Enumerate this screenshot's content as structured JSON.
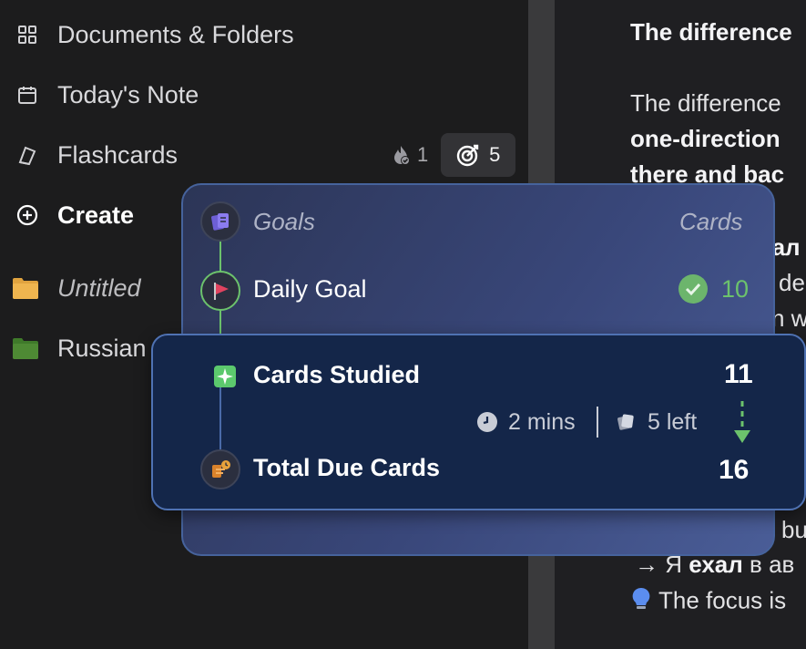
{
  "sidebar": {
    "items": [
      {
        "label": "Documents & Folders",
        "icon": "grid-icon"
      },
      {
        "label": "Today's Note",
        "icon": "calendar-icon"
      },
      {
        "label": "Flashcards",
        "icon": "flashcards-icon"
      },
      {
        "label": "Create",
        "icon": "plus-circle-icon"
      },
      {
        "label": "Untitled",
        "icon": "folder-icon",
        "color": "#e0a33f"
      },
      {
        "label": "Russian",
        "icon": "folder-icon",
        "color": "#4e8a34"
      }
    ],
    "flashcards_streak_count": "1",
    "flashcards_goal_count": "5"
  },
  "doc": {
    "heading": "The difference",
    "line1": "The difference",
    "line2": "one-direction",
    "line3": "there and bac",
    "line4": "ехал",
    "line5": "de",
    "line6": "n w",
    "line7": "bu",
    "line8_arrow": "→ Я",
    "line8_bold": "ехал",
    "line8_rest": "в ав",
    "line9": "The focus is"
  },
  "goals_popup": {
    "header_label": "Goals",
    "header_right": "Cards",
    "daily_goal_label": "Daily Goal",
    "daily_goal_value": "10",
    "cards_studied_label": "Cards Studied",
    "cards_studied_value": "11",
    "time_spent": "2 mins",
    "cards_left": "5 left",
    "total_due_label": "Total Due Cards",
    "total_due_value": "16"
  },
  "colors": {
    "accent_green": "#6cc26c",
    "card_front": "#142649",
    "card_back": "#39477a"
  }
}
